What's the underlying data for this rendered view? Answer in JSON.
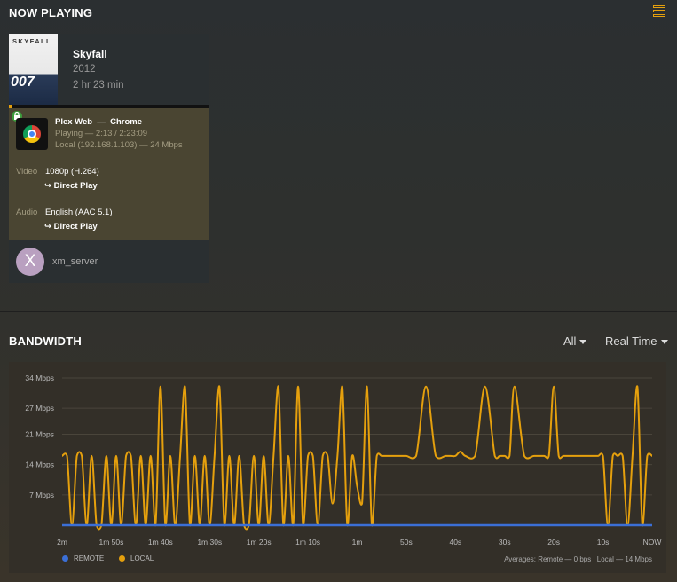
{
  "header": {
    "title": "NOW PLAYING"
  },
  "now_playing": {
    "poster_title": "SKYFALL",
    "poster_logo": "007",
    "title": "Skyfall",
    "year": "2012",
    "duration": "2 hr 23 min",
    "progress_fraction": 0.015,
    "player": {
      "name": "Plex Web",
      "separator": "—",
      "browser": "Chrome",
      "state": "Playing — 2:13 / 2:23:09",
      "network": "Local (192.168.1.103) — 24 Mbps"
    },
    "video": {
      "label": "Video",
      "value": "1080p (H.264)",
      "mode": "↪ Direct Play"
    },
    "audio": {
      "label": "Audio",
      "value": "English (AAC 5.1)",
      "mode": "↪ Direct Play"
    },
    "user": {
      "initial": "X",
      "name": "xm_server"
    }
  },
  "bandwidth": {
    "title": "BANDWIDTH",
    "filter_all": "All",
    "filter_time": "Real Time",
    "averages": "Averages: Remote — 0 bps | Local — 14 Mbps",
    "colors": {
      "remote": "#3b6fd6",
      "local": "#e5a00d"
    }
  },
  "chart_data": {
    "type": "line",
    "y_ticks": [
      "34 Mbps",
      "27 Mbps",
      "21 Mbps",
      "14 Mbps",
      "7 Mbps"
    ],
    "y_tick_values": [
      34,
      27,
      21,
      14,
      7
    ],
    "x_ticks": [
      "2m",
      "1m 50s",
      "1m 40s",
      "1m 30s",
      "1m 20s",
      "1m 10s",
      "1m",
      "50s",
      "40s",
      "30s",
      "20s",
      "10s",
      "NOW"
    ],
    "x_tick_seconds": [
      120,
      110,
      100,
      90,
      80,
      70,
      60,
      50,
      40,
      30,
      20,
      10,
      0
    ],
    "ylim": [
      0,
      34
    ],
    "xlim": [
      120,
      0
    ],
    "grid": true,
    "legend": "bottom-left",
    "series": [
      {
        "name": "REMOTE",
        "x": [
          120,
          0
        ],
        "values": [
          0,
          0
        ]
      },
      {
        "name": "LOCAL",
        "x": [
          120,
          119,
          118,
          117,
          116,
          115,
          114,
          113,
          112,
          111,
          110,
          109,
          108,
          107,
          106,
          105,
          104,
          103,
          102,
          101,
          100,
          99,
          98,
          97,
          96,
          95,
          94,
          93,
          92,
          91,
          90,
          89,
          88,
          87,
          86,
          85,
          84,
          83,
          82,
          81,
          80,
          79,
          78,
          77,
          76,
          75,
          74,
          73,
          72,
          71,
          70,
          69,
          68,
          67,
          66,
          65,
          64,
          63,
          62,
          61,
          60,
          59,
          58,
          57,
          56,
          55,
          54,
          53,
          52,
          51,
          50,
          48,
          46,
          44,
          42,
          41,
          40,
          39,
          38,
          36,
          34,
          32,
          31,
          30,
          29,
          28,
          26,
          24,
          22,
          21,
          20,
          19,
          18,
          16,
          14,
          12,
          11,
          10,
          9,
          8,
          7,
          6,
          5,
          4,
          3,
          2,
          1,
          0
        ],
        "values": [
          16,
          16,
          0,
          16,
          16,
          0,
          16,
          0,
          0,
          16,
          0,
          16,
          0,
          16,
          16,
          0,
          16,
          0,
          16,
          0,
          32,
          0,
          16,
          0,
          16,
          32,
          0,
          16,
          0,
          16,
          0,
          16,
          32,
          0,
          16,
          0,
          16,
          0,
          0,
          16,
          0,
          16,
          0,
          16,
          32,
          0,
          16,
          0,
          32,
          0,
          16,
          16,
          0,
          16,
          16,
          5,
          16,
          32,
          0,
          16,
          9,
          5,
          32,
          0,
          16,
          16,
          16,
          16,
          16,
          16,
          16,
          16,
          32,
          16,
          16,
          16,
          16,
          17,
          16,
          16,
          32,
          16,
          16,
          16,
          16,
          32,
          16,
          16,
          16,
          16,
          32,
          16,
          16,
          16,
          16,
          16,
          16,
          16,
          0,
          16,
          16,
          16,
          0,
          16,
          32,
          0,
          16,
          16
        ]
      }
    ]
  }
}
